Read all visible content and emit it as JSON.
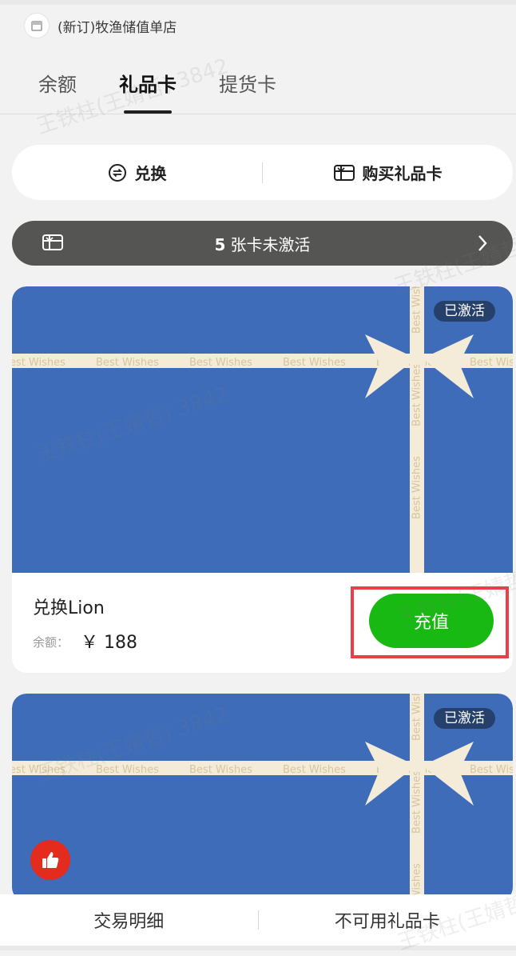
{
  "header": {
    "store_name": "(新订)牧渔储值单店",
    "store_icon": "store-icon"
  },
  "tabs": [
    {
      "label": "余额",
      "active": false
    },
    {
      "label": "礼品卡",
      "active": true
    },
    {
      "label": "提货卡",
      "active": false
    }
  ],
  "actions": {
    "redeem_label": "兑换",
    "redeem_icon": "exchange-icon",
    "buy_label": "购买礼品卡",
    "buy_icon": "gift-card-icon"
  },
  "inactive_bar": {
    "count": "5",
    "text": "张卡未激活",
    "icon": "gift-card-icon"
  },
  "ribbon_text": "Best Wishes",
  "cards": [
    {
      "status": "已激活",
      "title": "兑换Lion",
      "balance_label": "余额：",
      "balance_value": "￥ 188",
      "action_label": "充值",
      "art_color": "#3e6cb8"
    },
    {
      "status": "已激活",
      "art_color": "#3e6cb8"
    }
  ],
  "bottom_bar": {
    "left": "交易明细",
    "right": "不可用礼品卡"
  },
  "watermark": "王铁柱(王婧哲) 3842",
  "colors": {
    "accent_green": "#19b913",
    "highlight_red": "#e8404a",
    "badge_bg": "#26406c",
    "dark_bar": "#555553"
  }
}
